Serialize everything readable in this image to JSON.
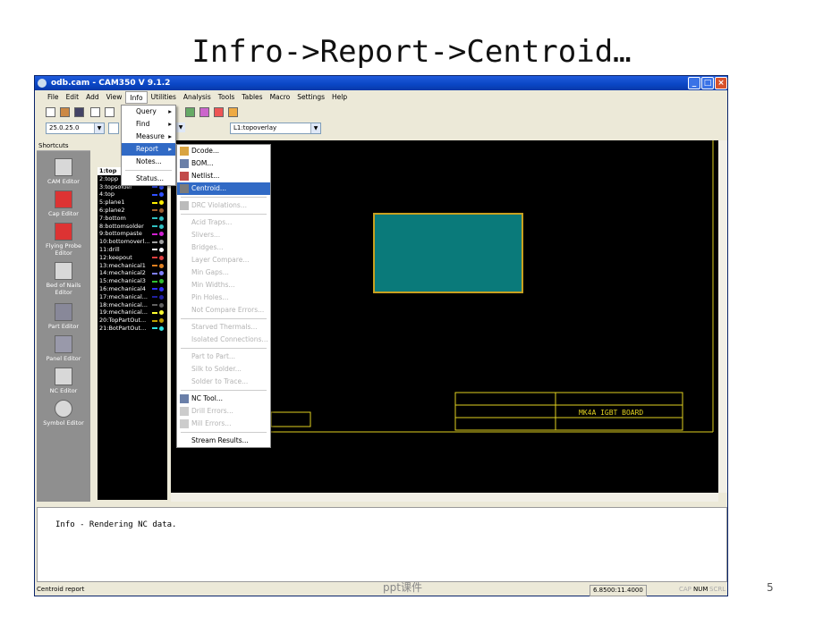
{
  "slide": {
    "title": "Infro->Report->Centroid…",
    "footer": "ppt课件",
    "page_number": "5"
  },
  "window": {
    "title": "odb.cam - CAM350 V 9.1.2"
  },
  "menubar": [
    "File",
    "Edit",
    "Add",
    "View",
    "Info",
    "Utilities",
    "Analysis",
    "Tools",
    "Tables",
    "Macro",
    "Settings",
    "Help"
  ],
  "toolbar": {
    "coord_combo": "25.0.25.0",
    "layer_combo": "L1:topoverlay"
  },
  "shortcuts": {
    "header": "Shortcuts",
    "items": [
      "CAM Editor",
      "Cap Editor",
      "Flying Probe Editor",
      "Bed of Nails Editor",
      "Part Editor",
      "Panel Editor",
      "NC Editor",
      "Symbol Editor"
    ]
  },
  "layers": [
    {
      "name": "1:top",
      "color": "#ffffff"
    },
    {
      "name": "2:topp",
      "color": "#888888"
    },
    {
      "name": "3:topsolder",
      "color": "#3050ff"
    },
    {
      "name": "4:top",
      "color": "#3050ff"
    },
    {
      "name": "5:plane1",
      "color": "#ffee00"
    },
    {
      "name": "6:plane2",
      "color": "#a06030"
    },
    {
      "name": "7:bottom",
      "color": "#30c0c0"
    },
    {
      "name": "8:bottomsolder",
      "color": "#30c0c0"
    },
    {
      "name": "9:bottompaste",
      "color": "#d020d0"
    },
    {
      "name": "10:bottomoverl...",
      "color": "#a0a0a0"
    },
    {
      "name": "11:drill",
      "color": "#ffffff"
    },
    {
      "name": "12:keepout",
      "color": "#e04040"
    },
    {
      "name": "13:mechanical1",
      "color": "#e08020"
    },
    {
      "name": "14:mechanical2",
      "color": "#8080ff"
    },
    {
      "name": "15:mechanical3",
      "color": "#30c030"
    },
    {
      "name": "16:mechanical4",
      "color": "#3030ff"
    },
    {
      "name": "17:mechanical...",
      "color": "#2020a0"
    },
    {
      "name": "18:mechanical...",
      "color": "#606060"
    },
    {
      "name": "19:mechanical...",
      "color": "#ffff30"
    },
    {
      "name": "20:TopPartOut...",
      "color": "#c0a000"
    },
    {
      "name": "21:BotPartOut...",
      "color": "#30e0e0"
    }
  ],
  "info_menu": [
    "Query",
    "Find",
    "Measure",
    "Report",
    "Notes...",
    "Status..."
  ],
  "report_menu": {
    "enabled_top": [
      "Dcode...",
      "BOM...",
      "Netlist...",
      "Centroid..."
    ],
    "disabled": [
      "DRC Violations...",
      "Acid Traps...",
      "Slivers...",
      "Bridges...",
      "Layer Compare...",
      "Min Gaps...",
      "Min Widths...",
      "Pin Holes...",
      "Not Compare Errors...",
      "Starved Thermals...",
      "Isolated Connections...",
      "Part to Part...",
      "Silk to Solder...",
      "Solder to Trace..."
    ],
    "nc": [
      "NC Tool...",
      "Drill Errors...",
      "Mill Errors..."
    ],
    "last": "Stream Results...",
    "selected": "Centroid..."
  },
  "output": {
    "message": "Info - Rendering NC data."
  },
  "statusbar": {
    "left": "Centroid report",
    "coords": "6.8500:11.4000",
    "caps": "CAP",
    "num": "NUM",
    "scrl": "SCRL"
  },
  "titleblock": {
    "board_name": "MK4A IGBT BOARD"
  }
}
